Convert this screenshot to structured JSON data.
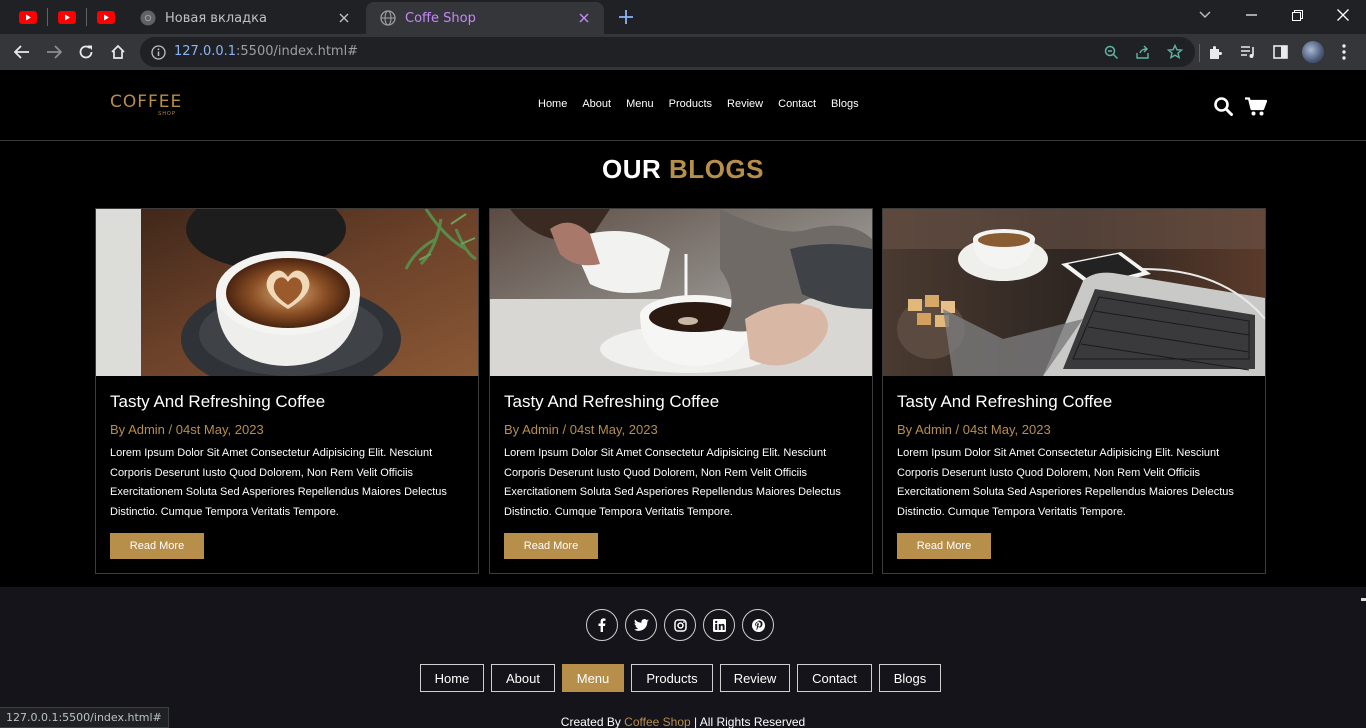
{
  "browser": {
    "tabs": [
      {
        "title": "Новая вкладка",
        "favicon": "chrome-icon",
        "active": false
      },
      {
        "title": "Coffe Shop",
        "favicon": "globe-icon",
        "active": true
      }
    ],
    "pinned_tabs": [
      "youtube-icon",
      "youtube-icon",
      "youtube-icon"
    ],
    "url_host": "127.0.0.1",
    "url_rest": ":5500/index.html#",
    "status_url": "127.0.0.1:5500/index.html#"
  },
  "header": {
    "logo_text": "COFFEE",
    "logo_sub": "SHOP",
    "nav": [
      "Home",
      "About",
      "Menu",
      "Products",
      "Review",
      "Contact",
      "Blogs"
    ]
  },
  "blogs": {
    "title_white": "OUR",
    "title_gold": "BLOGS",
    "cards": [
      {
        "title": "Tasty And Refreshing Coffee",
        "meta": "By Admin / 04st May, 2023",
        "text": "Lorem Ipsum Dolor Sit Amet Consectetur Adipisicing Elit. Nesciunt Corporis Deserunt Iusto Quod Dolorem, Non Rem Velit Officiis Exercitationem Soluta Sed Asperiores Repellendus Maiores Delectus Distinctio. Cumque Tempora Veritatis Tempore.",
        "button": "Read More",
        "image": "latte-art-cup-photo"
      },
      {
        "title": "Tasty And Refreshing Coffee",
        "meta": "By Admin / 04st May, 2023",
        "text": "Lorem Ipsum Dolor Sit Amet Consectetur Adipisicing Elit. Nesciunt Corporis Deserunt Iusto Quod Dolorem, Non Rem Velit Officiis Exercitationem Soluta Sed Asperiores Repellendus Maiores Delectus Distinctio. Cumque Tempora Veritatis Tempore.",
        "button": "Read More",
        "image": "pouring-milk-photo"
      },
      {
        "title": "Tasty And Refreshing Coffee",
        "meta": "By Admin / 04st May, 2023",
        "text": "Lorem Ipsum Dolor Sit Amet Consectetur Adipisicing Elit. Nesciunt Corporis Deserunt Iusto Quod Dolorem, Non Rem Velit Officiis Exercitationem Soluta Sed Asperiores Repellendus Maiores Delectus Distinctio. Cumque Tempora Veritatis Tempore.",
        "button": "Read More",
        "image": "coffee-laptop-photo"
      }
    ]
  },
  "footer": {
    "socials": [
      "facebook-icon",
      "twitter-icon",
      "instagram-icon",
      "linkedin-icon",
      "pinterest-icon"
    ],
    "links": [
      "Home",
      "About",
      "Menu",
      "Products",
      "Review",
      "Contact",
      "Blogs"
    ],
    "active_link": "Menu",
    "credit_prefix": "Created By",
    "credit_brand": "Coffee Shop",
    "credit_suffix": "| All Rights Reserved"
  },
  "colors": {
    "accent": "#b78e4a",
    "page_bg": "#000000",
    "footer_bg": "#14141a",
    "chrome_bg": "#202124"
  }
}
